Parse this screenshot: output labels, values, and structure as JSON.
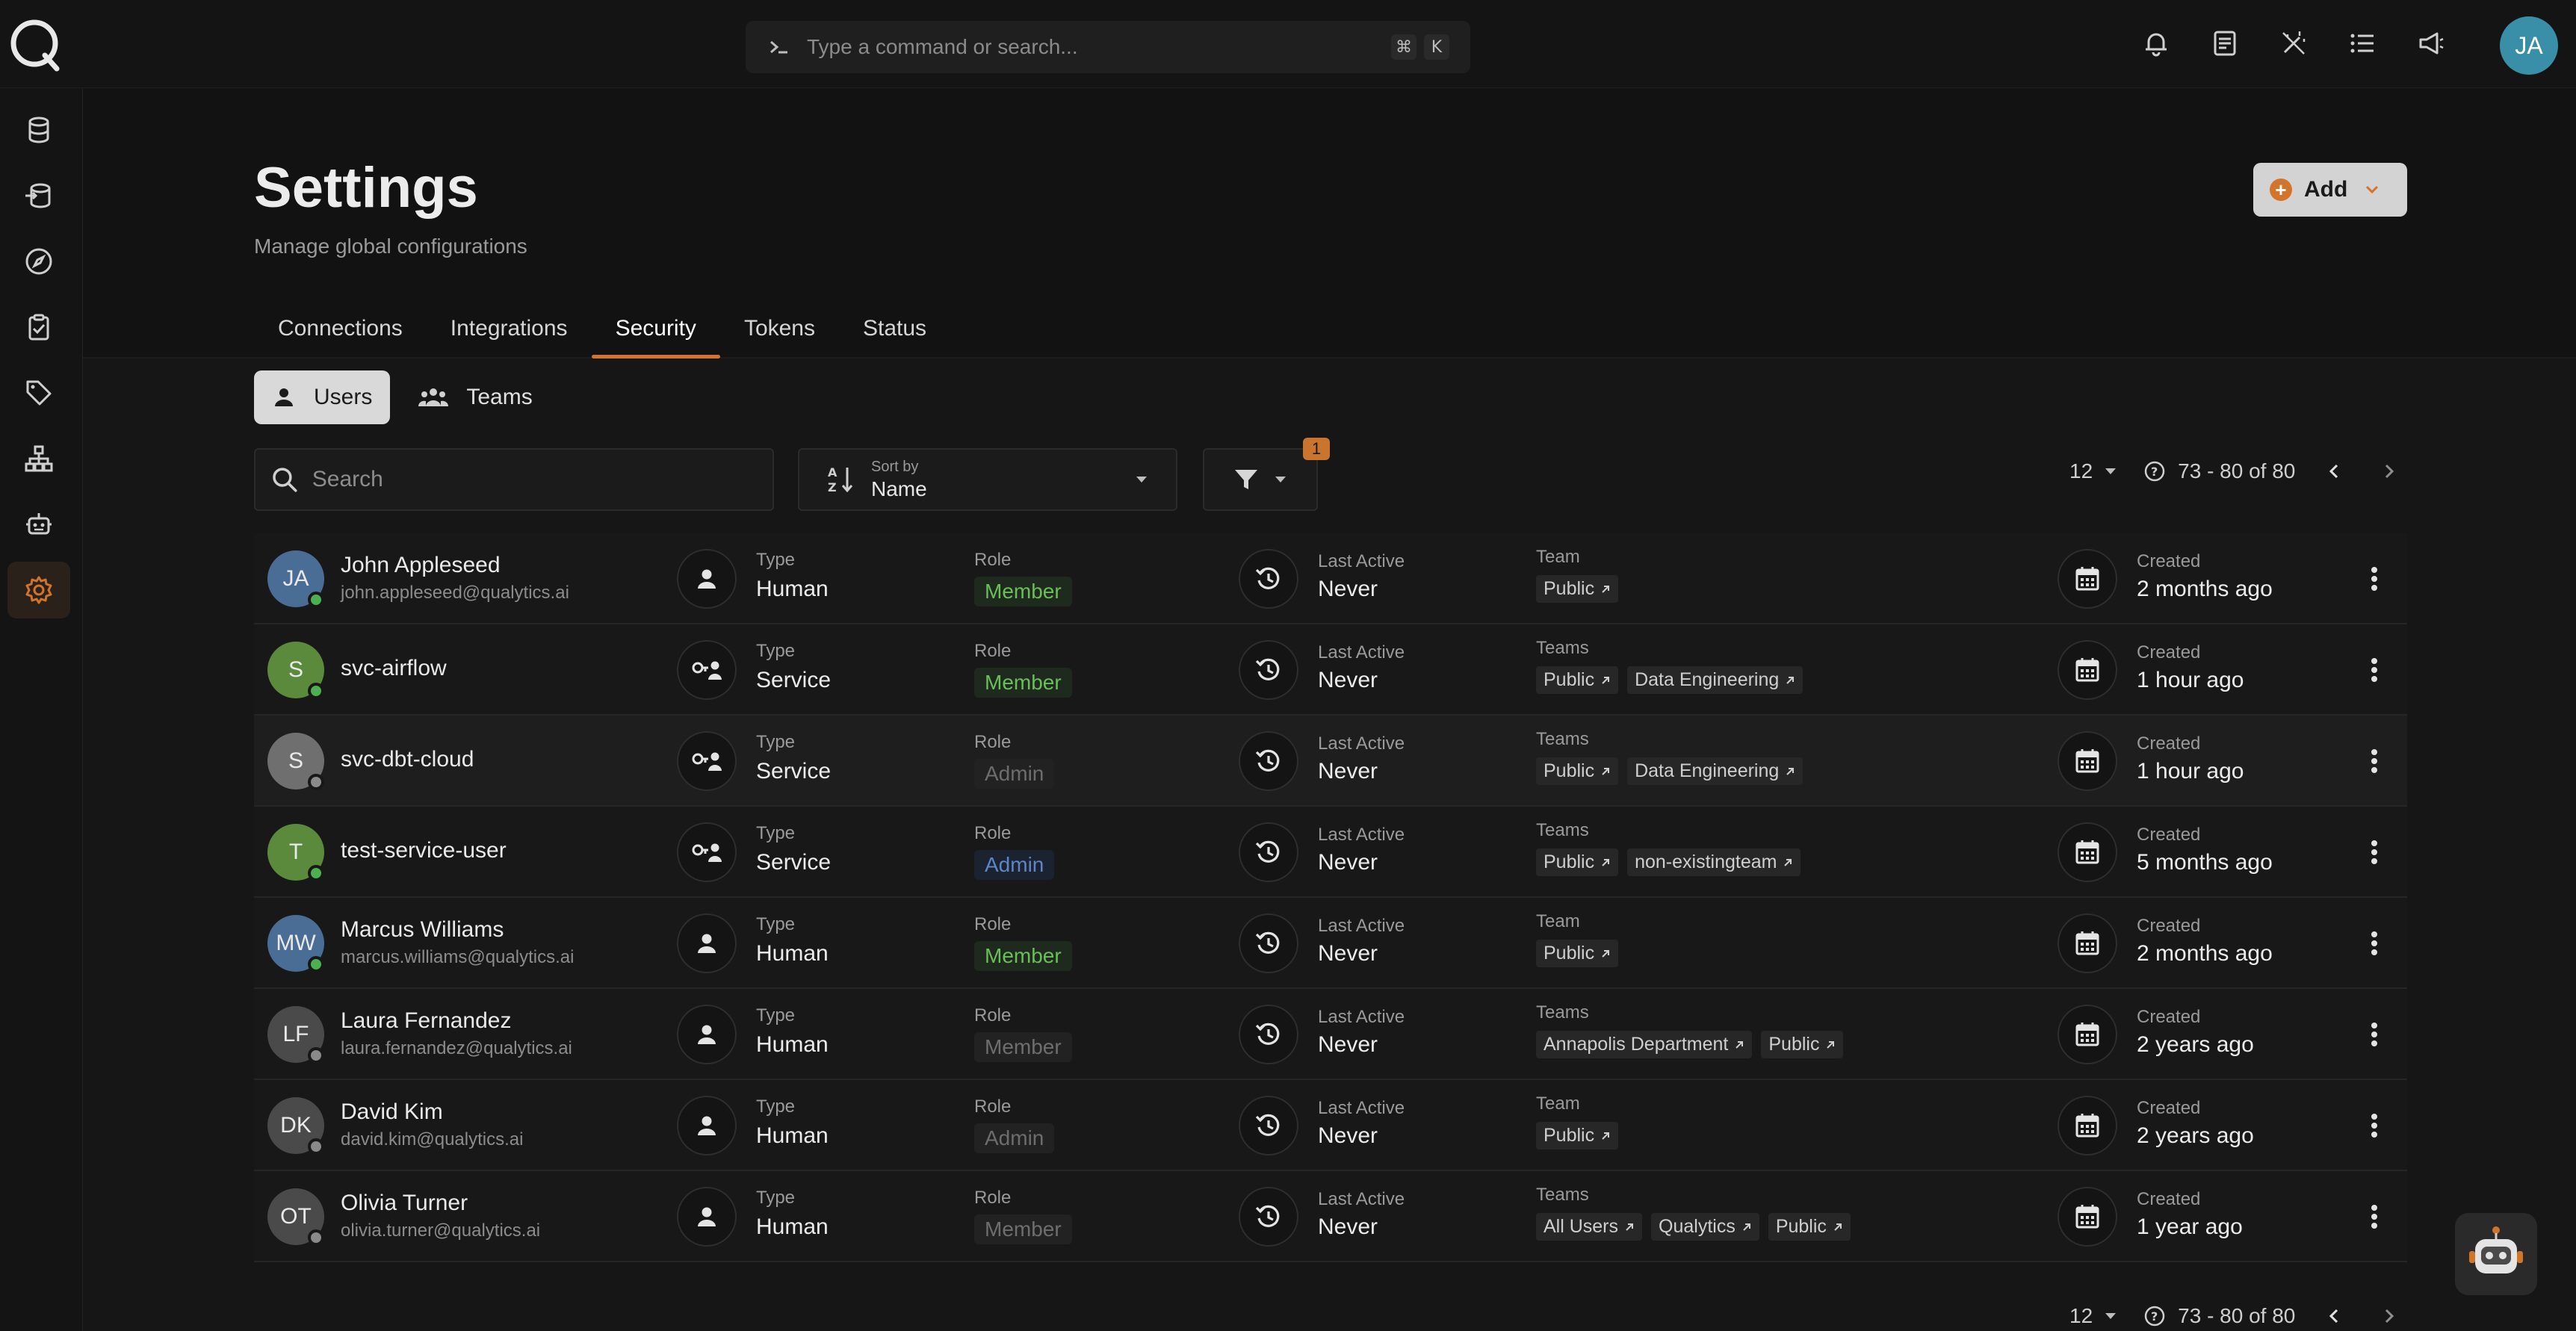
{
  "command_bar": {
    "placeholder": "Type a command or search...",
    "shortcut_mod": "⌘",
    "shortcut_key": "K"
  },
  "user_avatar": "JA",
  "header": {
    "title": "Settings",
    "subtitle": "Manage global configurations",
    "add_label": "Add"
  },
  "tabs": [
    "Connections",
    "Integrations",
    "Security",
    "Tokens",
    "Status"
  ],
  "active_tab": "Security",
  "subtabs": [
    "Users",
    "Teams"
  ],
  "search_placeholder": "Search",
  "sort": {
    "label": "Sort by",
    "value": "Name"
  },
  "filter_count": "1",
  "pagination": {
    "page_size": "12",
    "range": "73 - 80 of 80"
  },
  "columns": {
    "type": "Type",
    "role": "Role",
    "last_active": "Last Active",
    "team": "Team",
    "teams": "Teams",
    "created": "Created"
  },
  "users": [
    {
      "initials": "JA",
      "name": "John Appleseed",
      "email": "john.appleseed@qualytics.ai",
      "avatar_color": "#4a6d96",
      "status_color": "#4caf50",
      "type": "Human",
      "role": "Member",
      "role_style": "member",
      "last_active": "Never",
      "team_label": "Team",
      "teams": [
        "Public"
      ],
      "created": "2 months ago"
    },
    {
      "initials": "S",
      "name": "svc-airflow",
      "email": "",
      "avatar_color": "#5b8a3c",
      "status_color": "#4caf50",
      "type": "Service",
      "role": "Member",
      "role_style": "member",
      "last_active": "Never",
      "team_label": "Teams",
      "teams": [
        "Public",
        "Data Engineering"
      ],
      "created": "1 hour ago"
    },
    {
      "initials": "S",
      "name": "svc-dbt-cloud",
      "email": "",
      "avatar_color": "#6f6f6f",
      "status_color": "#8a8a8a",
      "type": "Service",
      "role": "Admin",
      "role_style": "admin-dim",
      "last_active": "Never",
      "team_label": "Teams",
      "teams": [
        "Public",
        "Data Engineering"
      ],
      "created": "1 hour ago"
    },
    {
      "initials": "T",
      "name": "test-service-user",
      "email": "",
      "avatar_color": "#5b8a3c",
      "status_color": "#4caf50",
      "type": "Service",
      "role": "Admin",
      "role_style": "admin-blue",
      "last_active": "Never",
      "team_label": "Teams",
      "teams": [
        "Public",
        "non-existingteam"
      ],
      "created": "5 months ago"
    },
    {
      "initials": "MW",
      "name": "Marcus Williams",
      "email": "marcus.williams@qualytics.ai",
      "avatar_color": "#4a6d96",
      "status_color": "#4caf50",
      "type": "Human",
      "role": "Member",
      "role_style": "member",
      "last_active": "Never",
      "team_label": "Team",
      "teams": [
        "Public"
      ],
      "created": "2 months ago"
    },
    {
      "initials": "LF",
      "name": "Laura Fernandez",
      "email": "laura.fernandez@qualytics.ai",
      "avatar_color": "#4a4a4a",
      "status_color": "#8a8a8a",
      "type": "Human",
      "role": "Member",
      "role_style": "member-dim",
      "last_active": "Never",
      "team_label": "Teams",
      "teams": [
        "Annapolis Department",
        "Public"
      ],
      "created": "2 years ago"
    },
    {
      "initials": "DK",
      "name": "David Kim",
      "email": "david.kim@qualytics.ai",
      "avatar_color": "#4a4a4a",
      "status_color": "#8a8a8a",
      "type": "Human",
      "role": "Admin",
      "role_style": "admin-dim",
      "last_active": "Never",
      "team_label": "Team",
      "teams": [
        "Public"
      ],
      "created": "2 years ago"
    },
    {
      "initials": "OT",
      "name": "Olivia Turner",
      "email": "olivia.turner@qualytics.ai",
      "avatar_color": "#4a4a4a",
      "status_color": "#8a8a8a",
      "type": "Human",
      "role": "Member",
      "role_style": "member-dim",
      "last_active": "Never",
      "team_label": "Teams",
      "teams": [
        "All Users",
        "Qualytics",
        "Public"
      ],
      "created": "1 year ago"
    }
  ],
  "colors": {
    "accent": "#d2752b",
    "background": "#121212"
  }
}
